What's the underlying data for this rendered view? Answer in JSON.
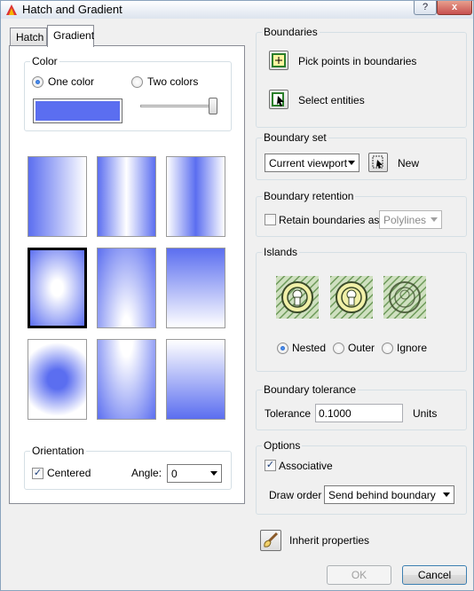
{
  "window": {
    "title": "Hatch and Gradient",
    "help_label": "?",
    "close_label": "x"
  },
  "tabs": [
    {
      "label": "Hatch"
    },
    {
      "label": "Gradient"
    }
  ],
  "color": {
    "group_label": "Color",
    "one_color_label": "One color",
    "two_colors_label": "Two colors",
    "selected": "One color",
    "swatch_color": "#5b6ef0",
    "shade_slider_fraction": 0.95
  },
  "orientation": {
    "group_label": "Orientation",
    "centered_label": "Centered",
    "centered_checked": true,
    "angle_label": "Angle:",
    "angle_value": "0"
  },
  "boundaries": {
    "group_label": "Boundaries",
    "pick_points_label": "Pick points in boundaries",
    "select_entities_label": "Select entities"
  },
  "boundary_set": {
    "group_label": "Boundary set",
    "value": "Current viewport",
    "new_label": "New"
  },
  "boundary_retention": {
    "group_label": "Boundary retention",
    "retain_label": "Retain boundaries as",
    "retain_checked": false,
    "type_value": "Polylines"
  },
  "islands": {
    "group_label": "Islands",
    "nested_label": "Nested",
    "outer_label": "Outer",
    "ignore_label": "Ignore",
    "selected": "Nested"
  },
  "boundary_tolerance": {
    "group_label": "Boundary tolerance",
    "tolerance_label": "Tolerance",
    "tolerance_value": "0.1000",
    "units_label": "Units"
  },
  "options": {
    "group_label": "Options",
    "associative_label": "Associative",
    "associative_checked": true,
    "draw_order_label": "Draw order",
    "draw_order_value": "Send behind boundary"
  },
  "inherit_label": "Inherit properties",
  "ok_label": "OK",
  "cancel_label": "Cancel",
  "check_mark": "✓"
}
